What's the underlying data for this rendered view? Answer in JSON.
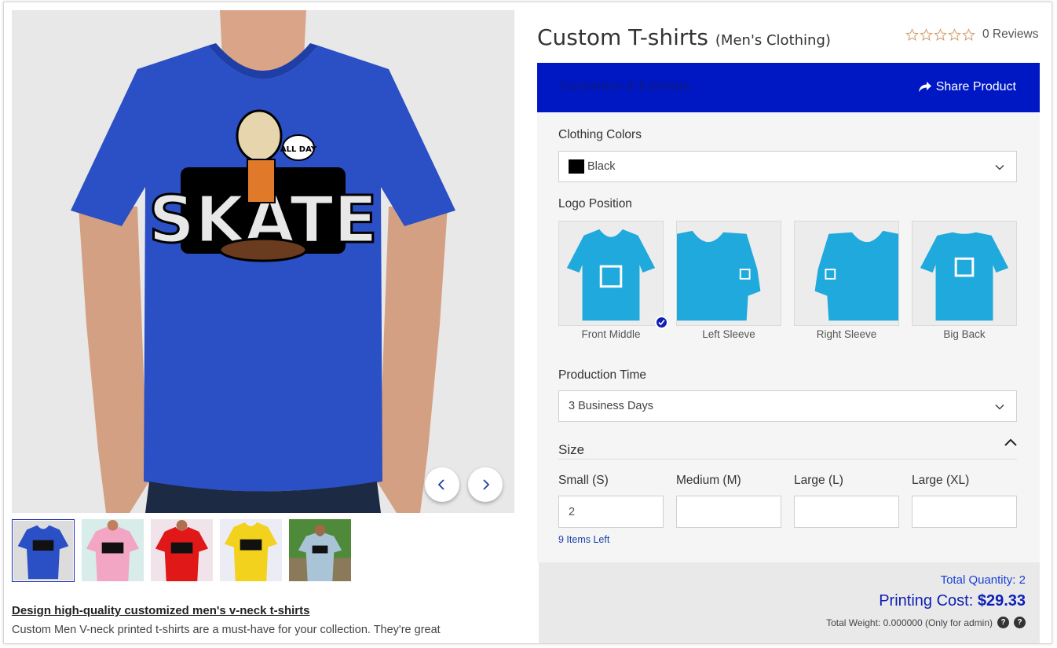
{
  "product": {
    "title": "Custom T-shirts",
    "category": "(Men's Clothing)",
    "reviews_text": "0 Reviews",
    "rating_stars": 0,
    "rating_max": 5
  },
  "header_bar": {
    "tab_label": "Customize & Estimate",
    "share_label": "Share Product",
    "background_color": "#0018c4"
  },
  "gallery": {
    "prev_icon": "chevron-left-icon",
    "next_icon": "chevron-right-icon",
    "thumbnails": [
      {
        "color": "blue-shirt",
        "active": true
      },
      {
        "color": "pink-shirt",
        "active": false
      },
      {
        "color": "red-shirt",
        "active": false
      },
      {
        "color": "yellow-shirt",
        "active": false
      },
      {
        "color": "grey-shirt-outdoor",
        "active": false
      }
    ]
  },
  "clothing_colors": {
    "label": "Clothing Colors",
    "selected": "Black",
    "swatch_color": "#000000"
  },
  "logo_position": {
    "label": "Logo Position",
    "options": [
      {
        "label": "Front Middle",
        "selected": true
      },
      {
        "label": "Left Sleeve",
        "selected": false
      },
      {
        "label": "Right Sleeve",
        "selected": false
      },
      {
        "label": "Big Back",
        "selected": false
      }
    ]
  },
  "production_time": {
    "label": "Production Time",
    "selected": "3 Business Days"
  },
  "size": {
    "title": "Size",
    "columns": [
      {
        "label": "Small (S)",
        "value": "2"
      },
      {
        "label": "Medium (M)",
        "value": ""
      },
      {
        "label": "Large (L)",
        "value": ""
      },
      {
        "label": "Large (XL)",
        "value": ""
      }
    ],
    "items_left": "9 Items Left"
  },
  "summary": {
    "total_quantity": "Total Quantity: 2",
    "printing_cost_label": "Printing Cost:",
    "printing_cost_value": "$29.33",
    "total_weight": "Total Weight: 0.000000 (Only for admin)"
  },
  "description": {
    "title": "Design high-quality customized men's v-neck t-shirts",
    "text": "Custom Men V-neck printed t-shirts are a must-have for your collection. They're great"
  },
  "colors": {
    "accent": "#0018c4",
    "link": "#1b3fd8",
    "shirt_blue": "#2b4fc4",
    "mockup_cyan": "#1fa9dc"
  }
}
